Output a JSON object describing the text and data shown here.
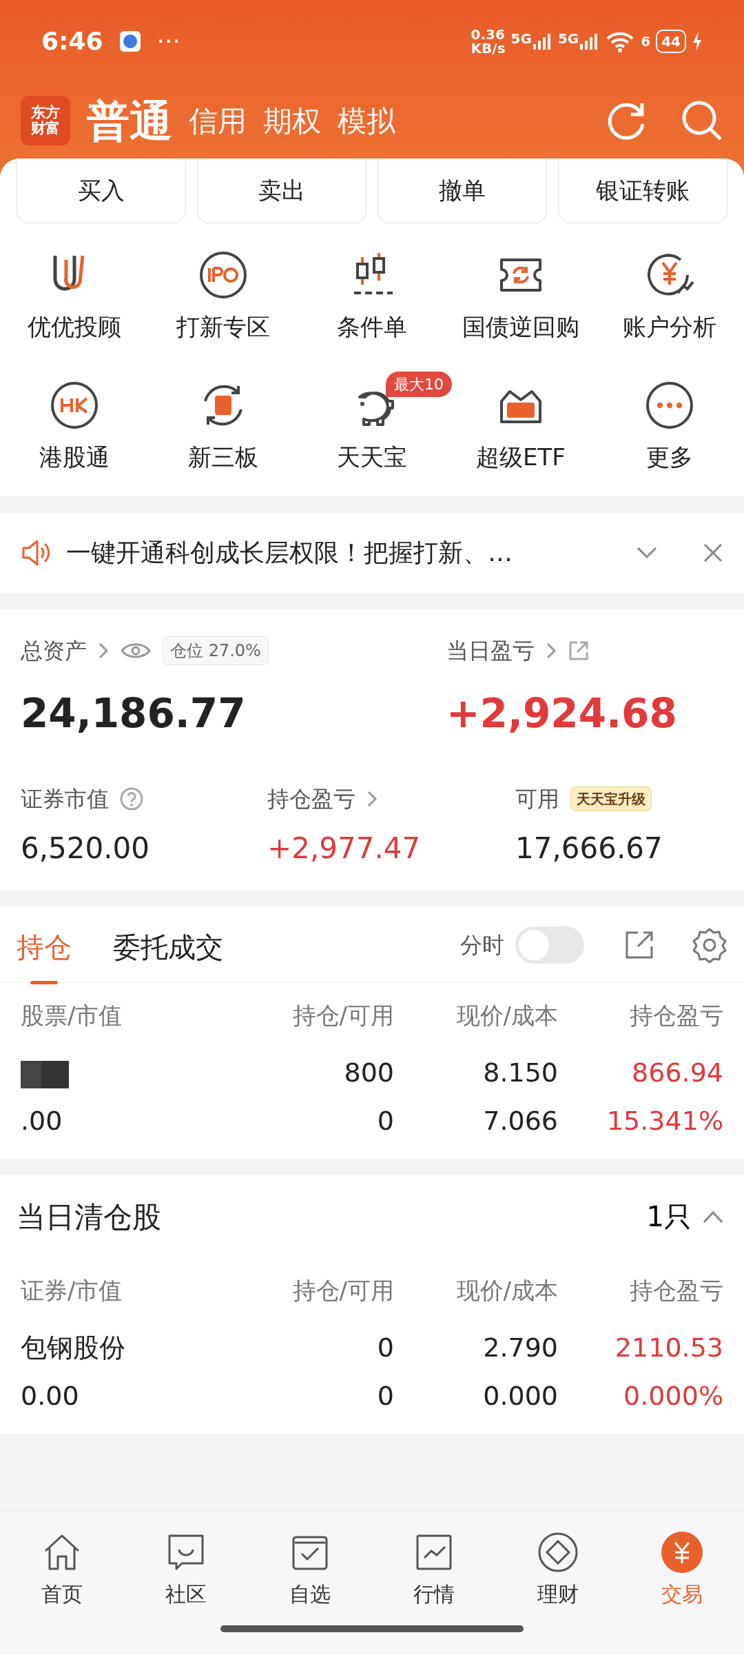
{
  "status_bar": {
    "time": "6:46",
    "dots": "···",
    "net_speed_value": "0.36",
    "net_speed_unit": "KB/s",
    "sim_1": "5G",
    "sim_2": "5G",
    "wifi_gen": "6",
    "battery": "44",
    "charging": true
  },
  "header": {
    "logo_lines": [
      "东方",
      "财富"
    ],
    "tabs": [
      {
        "label": "普通",
        "selected": true
      },
      {
        "label": "信用",
        "selected": false
      },
      {
        "label": "期权",
        "selected": false
      },
      {
        "label": "模拟",
        "selected": false
      }
    ]
  },
  "quick_actions": [
    "买入",
    "卖出",
    "撤单",
    "银证转账"
  ],
  "features": [
    {
      "label": "优优投顾"
    },
    {
      "label": "打新专区"
    },
    {
      "label": "条件单"
    },
    {
      "label": "国债逆回购"
    },
    {
      "label": "账户分析"
    },
    {
      "label": "港股通"
    },
    {
      "label": "新三板"
    },
    {
      "label": "天天宝",
      "badge": "最大10"
    },
    {
      "label": "超级ETF"
    },
    {
      "label": "更多"
    }
  ],
  "notice": {
    "text": "一键开通科创成长层权限！把握打新、…"
  },
  "assets": {
    "total": {
      "label": "总资产",
      "value": "24,186.77",
      "position_label": "仓位",
      "position_value": "27.0%"
    },
    "daily_pnl": {
      "label": "当日盈亏",
      "value": "+2,924.68"
    },
    "market_value": {
      "label": "证券市值",
      "value": "6,520.00"
    },
    "holding_pnl": {
      "label": "持仓盈亏",
      "value": "+2,977.47"
    },
    "available": {
      "label": "可用",
      "value": "17,666.67",
      "badge": "天天宝升级"
    }
  },
  "positions": {
    "tabs": [
      {
        "label": "持仓",
        "selected": true
      },
      {
        "label": "委托成交",
        "selected": false
      }
    ],
    "toggle": {
      "label": "分时",
      "on": false
    },
    "columns": [
      "股票/市值",
      "持仓/可用",
      "现价/成本",
      "持仓盈亏"
    ],
    "rows": [
      {
        "redacted": true,
        "value": ".00",
        "quantity": "800",
        "available": "0",
        "price": "8.150",
        "cost": "7.066",
        "pnl": "866.94",
        "pnl_pct": "15.341%"
      }
    ]
  },
  "cleared": {
    "title": "当日清仓股",
    "count": "1只",
    "expanded": true,
    "columns": [
      "证券/市值",
      "持仓/可用",
      "现价/成本",
      "持仓盈亏"
    ],
    "rows": [
      {
        "name": "包钢股份",
        "value": "0.00",
        "quantity": "0",
        "available": "0",
        "price": "2.790",
        "cost": "0.000",
        "pnl": "2110.53",
        "pnl_pct": "0.000%"
      }
    ]
  },
  "bottom_nav": [
    {
      "label": "首页",
      "selected": false
    },
    {
      "label": "社区",
      "selected": false
    },
    {
      "label": "自选",
      "selected": false
    },
    {
      "label": "行情",
      "selected": false
    },
    {
      "label": "理财",
      "selected": false
    },
    {
      "label": "交易",
      "selected": true
    }
  ]
}
